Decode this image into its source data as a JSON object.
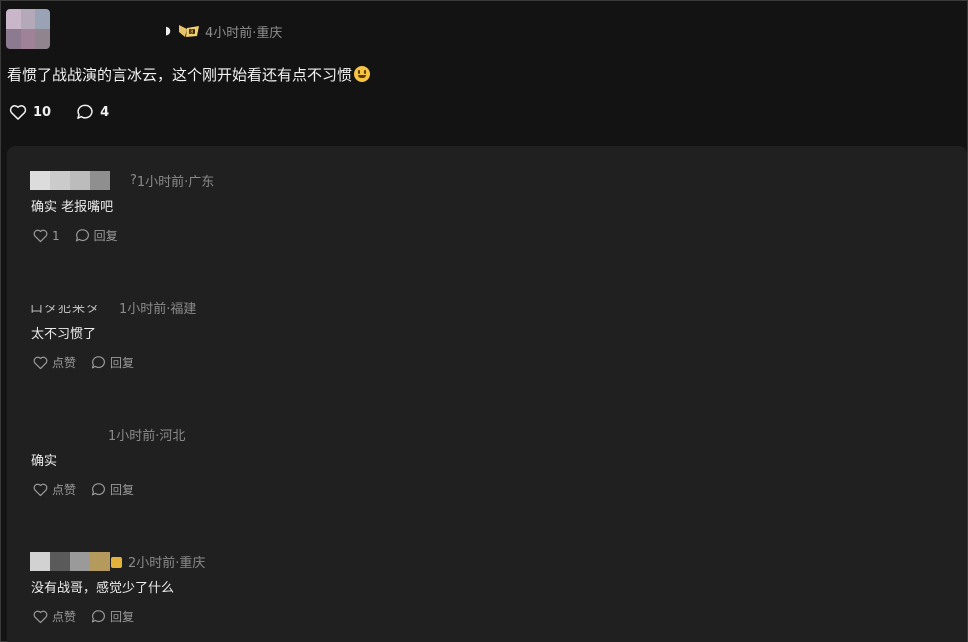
{
  "post": {
    "time_location": "4小时前·重庆",
    "text": "看惯了战战演的言冰云，这个刚开始看还有点不习惯",
    "likes": "10",
    "comments": "4",
    "avatar_colors": [
      "#c9b6c8",
      "#b3a9b8",
      "#9aa3b5",
      "#8c7a90",
      "#a08298",
      "#90848f"
    ],
    "badge_icon": "medal-badge-icon"
  },
  "replies": [
    {
      "time_location": "1小时前·广东",
      "time_prefix": "?",
      "text": "确实 老报嘴吧",
      "like_label": "1",
      "reply_label": "回复",
      "name_colors": [
        "#dcdcdc",
        "#cbcbcb",
        "#bcbcbc",
        "#8f8f8f"
      ]
    },
    {
      "time_location": "1小时前·福建",
      "text": "太不习惯了",
      "like_label": "点赞",
      "reply_label": "回复",
      "name_fragment": "口タ犯来タ分"
    },
    {
      "time_location": "1小时前·河北",
      "text": "确实",
      "like_label": "点赞",
      "reply_label": "回复"
    },
    {
      "time_location": "2小时前·重庆",
      "text": "没有战哥，感觉少了什么",
      "like_label": "点赞",
      "reply_label": "回复",
      "name_colors": [
        "#d2d2d2",
        "#5a5a5a",
        "#9a9a9a",
        "#b59a5e"
      ]
    }
  ],
  "colors": {
    "page_bg": "#131313",
    "panel_bg": "#202020",
    "meta_text": "#8e8e8e",
    "badge": "#e2b23a"
  }
}
